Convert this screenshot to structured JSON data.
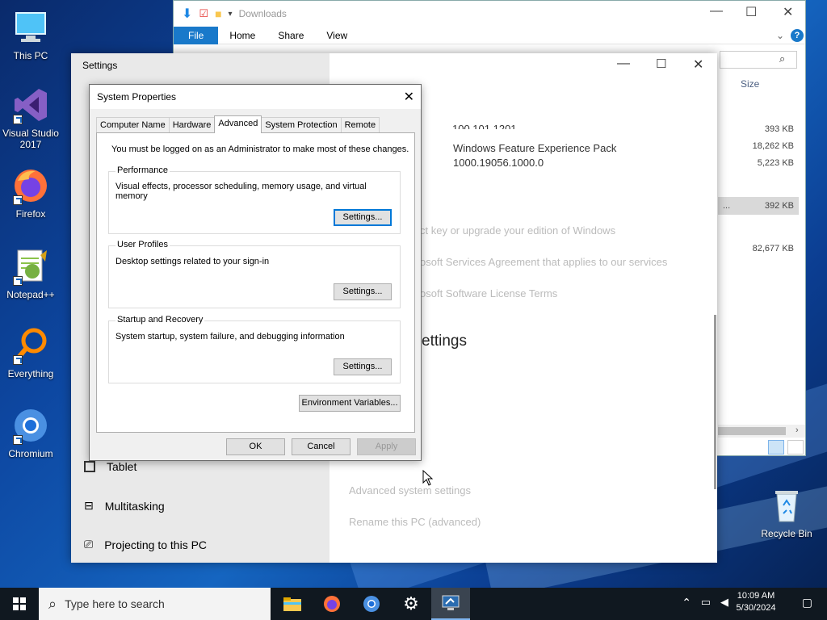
{
  "desktop_icons": [
    "This PC",
    "Visual Studio 2017",
    "Firefox",
    "Notepad++",
    "Everything",
    "Chromium",
    "Recycle Bin"
  ],
  "explorer": {
    "title": "Downloads",
    "ribbon_tabs": [
      "File",
      "Home",
      "Share",
      "View"
    ],
    "column_size": "Size",
    "sizes": [
      "393 KB",
      "18,262 KB",
      "5,223 KB",
      "392 KB",
      "82,677 KB"
    ],
    "dots": "..."
  },
  "settings": {
    "title": "Settings",
    "nav_items": [
      "Tablet",
      "Multitasking",
      "Projecting to this PC"
    ],
    "pack_name": "Windows Feature Experience Pack",
    "pack_version": "1000.19056.1000.0",
    "links": [
      "ct key or upgrade your edition of Windows",
      "osoft Services Agreement that applies to our services",
      "osoft Software License Terms"
    ],
    "related_heading": "ettings",
    "related_links": [
      "Advanced system settings",
      "Rename this PC (advanced)"
    ],
    "partial_num": "100.101.1201"
  },
  "sysprops": {
    "title": "System Properties",
    "tabs": [
      "Computer Name",
      "Hardware",
      "Advanced",
      "System Protection",
      "Remote"
    ],
    "admin_note": "You must be logged on as an Administrator to make most of these changes.",
    "performance": {
      "title": "Performance",
      "desc": "Visual effects, processor scheduling, memory usage, and virtual memory"
    },
    "user_profiles": {
      "title": "User Profiles",
      "desc": "Desktop settings related to your sign-in"
    },
    "startup": {
      "title": "Startup and Recovery",
      "desc": "System startup, system failure, and debugging information"
    },
    "settings_btn": "Settings...",
    "env_btn": "Environment Variables...",
    "ok": "OK",
    "cancel": "Cancel",
    "apply": "Apply"
  },
  "taskbar": {
    "search_placeholder": "Type here to search",
    "time": "10:09 AM",
    "date": "5/30/2024"
  },
  "colors": {
    "accent": "#0078d7",
    "taskbar": "#101820"
  }
}
